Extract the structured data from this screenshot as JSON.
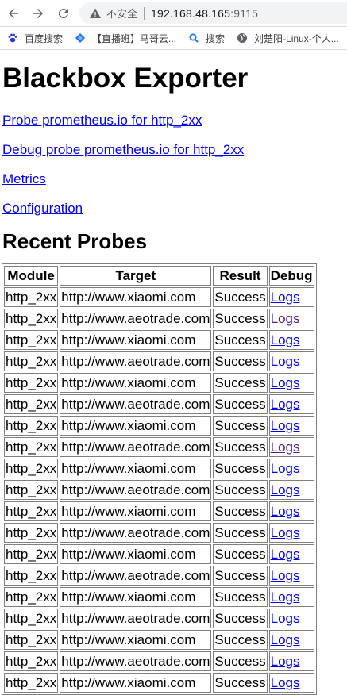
{
  "browser": {
    "security_label": "不安全",
    "url_host": "192.168.48.165",
    "url_port": ":9115",
    "bookmarks": [
      {
        "label": "百度搜索",
        "icon": "paw-icon"
      },
      {
        "label": "【直播班】马哥云...",
        "icon": "diamond-icon"
      },
      {
        "label": "搜索",
        "icon": "search-icon"
      },
      {
        "label": "刘楚阳-Linux-个人...",
        "icon": "globe-icon"
      }
    ]
  },
  "page": {
    "title": "Blackbox Exporter",
    "links": {
      "probe": "Probe prometheus.io for http_2xx",
      "debug_probe": "Debug probe prometheus.io for http_2xx",
      "metrics": "Metrics",
      "configuration": "Configuration"
    },
    "recent_title": "Recent Probes",
    "table": {
      "headers": [
        "Module",
        "Target",
        "Result",
        "Debug"
      ],
      "rows": [
        {
          "module": "http_2xx",
          "target": "http://www.xiaomi.com",
          "result": "Success",
          "debug": "Logs",
          "visited": false
        },
        {
          "module": "http_2xx",
          "target": "http://www.aeotrade.com",
          "result": "Success",
          "debug": "Logs",
          "visited": true
        },
        {
          "module": "http_2xx",
          "target": "http://www.xiaomi.com",
          "result": "Success",
          "debug": "Logs",
          "visited": false
        },
        {
          "module": "http_2xx",
          "target": "http://www.aeotrade.com",
          "result": "Success",
          "debug": "Logs",
          "visited": false
        },
        {
          "module": "http_2xx",
          "target": "http://www.xiaomi.com",
          "result": "Success",
          "debug": "Logs",
          "visited": false
        },
        {
          "module": "http_2xx",
          "target": "http://www.aeotrade.com",
          "result": "Success",
          "debug": "Logs",
          "visited": false
        },
        {
          "module": "http_2xx",
          "target": "http://www.xiaomi.com",
          "result": "Success",
          "debug": "Logs",
          "visited": false
        },
        {
          "module": "http_2xx",
          "target": "http://www.aeotrade.com",
          "result": "Success",
          "debug": "Logs",
          "visited": true
        },
        {
          "module": "http_2xx",
          "target": "http://www.xiaomi.com",
          "result": "Success",
          "debug": "Logs",
          "visited": false
        },
        {
          "module": "http_2xx",
          "target": "http://www.aeotrade.com",
          "result": "Success",
          "debug": "Logs",
          "visited": false
        },
        {
          "module": "http_2xx",
          "target": "http://www.xiaomi.com",
          "result": "Success",
          "debug": "Logs",
          "visited": false
        },
        {
          "module": "http_2xx",
          "target": "http://www.aeotrade.com",
          "result": "Success",
          "debug": "Logs",
          "visited": false
        },
        {
          "module": "http_2xx",
          "target": "http://www.xiaomi.com",
          "result": "Success",
          "debug": "Logs",
          "visited": false
        },
        {
          "module": "http_2xx",
          "target": "http://www.aeotrade.com",
          "result": "Success",
          "debug": "Logs",
          "visited": false
        },
        {
          "module": "http_2xx",
          "target": "http://www.xiaomi.com",
          "result": "Success",
          "debug": "Logs",
          "visited": false
        },
        {
          "module": "http_2xx",
          "target": "http://www.aeotrade.com",
          "result": "Success",
          "debug": "Logs",
          "visited": false
        },
        {
          "module": "http_2xx",
          "target": "http://www.xiaomi.com",
          "result": "Success",
          "debug": "Logs",
          "visited": false
        },
        {
          "module": "http_2xx",
          "target": "http://www.aeotrade.com",
          "result": "Success",
          "debug": "Logs",
          "visited": false
        },
        {
          "module": "http_2xx",
          "target": "http://www.xiaomi.com",
          "result": "Success",
          "debug": "Logs",
          "visited": false
        }
      ]
    }
  },
  "colors": {
    "link": "#0000ee",
    "visited_link": "#551a8b",
    "table_border": "#808080"
  }
}
